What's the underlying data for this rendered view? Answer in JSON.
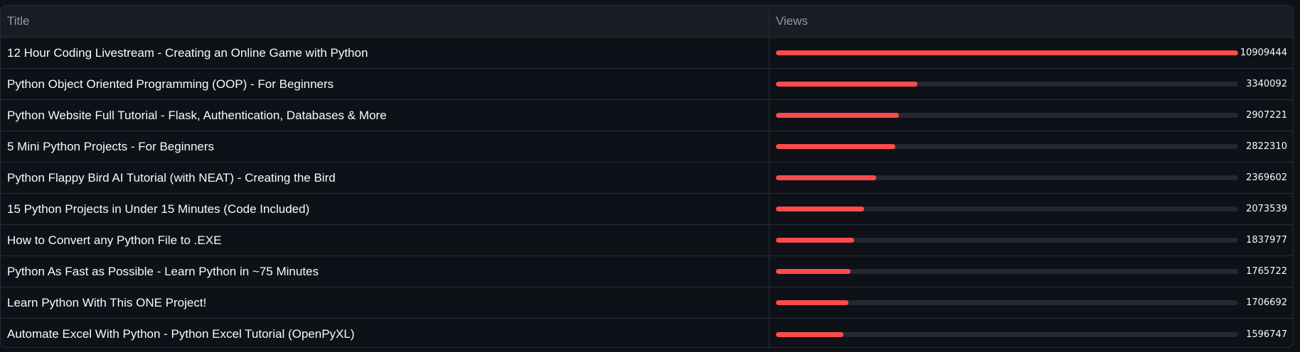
{
  "table": {
    "columns": {
      "title": "Title",
      "views": "Views"
    },
    "max_views": 10909444,
    "colors": {
      "bar_fill": "#ff4b4b",
      "bar_track": "#262730",
      "background": "#0e1117",
      "header_bg": "#1a1c24"
    },
    "rows": [
      {
        "title": "12 Hour Coding Livestream - Creating an Online Game with Python",
        "views": 10909444,
        "views_label": "10909444"
      },
      {
        "title": "Python Object Oriented Programming (OOP) - For Beginners",
        "views": 3340092,
        "views_label": "3340092"
      },
      {
        "title": "Python Website Full Tutorial - Flask, Authentication, Databases & More",
        "views": 2907221,
        "views_label": "2907221"
      },
      {
        "title": "5 Mini Python Projects - For Beginners",
        "views": 2822310,
        "views_label": "2822310"
      },
      {
        "title": "Python Flappy Bird AI Tutorial (with NEAT) - Creating the Bird",
        "views": 2369602,
        "views_label": "2369602"
      },
      {
        "title": "15 Python Projects in Under 15 Minutes (Code Included)",
        "views": 2073539,
        "views_label": "2073539"
      },
      {
        "title": "How to Convert any Python File to .EXE",
        "views": 1837977,
        "views_label": "1837977"
      },
      {
        "title": "Python As Fast as Possible - Learn Python in ~75 Minutes",
        "views": 1765722,
        "views_label": "1765722"
      },
      {
        "title": "Learn Python With This ONE Project!",
        "views": 1706692,
        "views_label": "1706692"
      },
      {
        "title": "Automate Excel With Python - Python Excel Tutorial (OpenPyXL)",
        "views": 1596747,
        "views_label": "1596747"
      }
    ]
  }
}
